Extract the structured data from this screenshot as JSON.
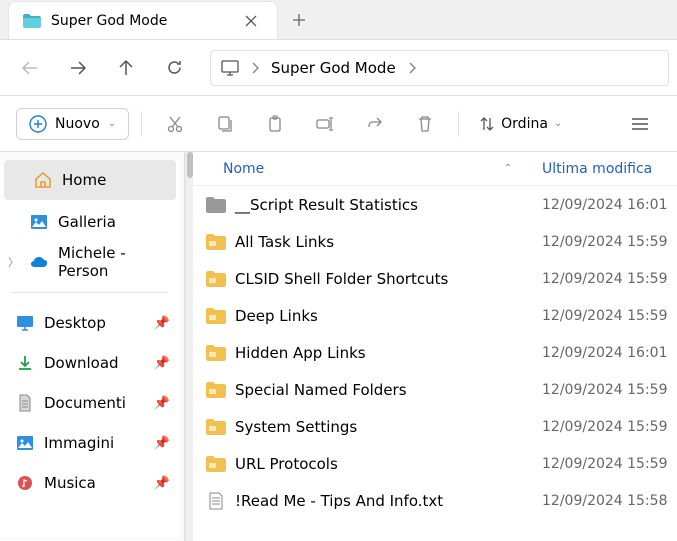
{
  "tab": {
    "title": "Super God Mode"
  },
  "breadcrumb": {
    "current": "Super God Mode"
  },
  "toolbar": {
    "new_label": "Nuovo",
    "sort_label": "Ordina"
  },
  "columns": {
    "name": "Nome",
    "modified": "Ultima modifica"
  },
  "sidebar": {
    "nav": [
      {
        "label": "Home",
        "icon": "home",
        "selected": true
      },
      {
        "label": "Galleria",
        "icon": "gallery"
      },
      {
        "label": "Michele - Person",
        "icon": "onedrive",
        "expandable": true
      }
    ],
    "quick": [
      {
        "label": "Desktop",
        "icon": "desktop"
      },
      {
        "label": "Download",
        "icon": "download"
      },
      {
        "label": "Documenti",
        "icon": "documents"
      },
      {
        "label": "Immagini",
        "icon": "pictures"
      },
      {
        "label": "Musica",
        "icon": "music"
      }
    ]
  },
  "files": [
    {
      "name": "__Script Result Statistics",
      "date": "12/09/2024 16:01",
      "icon": "folder-gray"
    },
    {
      "name": "All Task Links",
      "date": "12/09/2024 15:59",
      "icon": "folder-tasks"
    },
    {
      "name": "CLSID Shell Folder Shortcuts",
      "date": "12/09/2024 15:59",
      "icon": "folder-shell"
    },
    {
      "name": "Deep Links",
      "date": "12/09/2024 15:59",
      "icon": "folder-deep"
    },
    {
      "name": "Hidden App Links",
      "date": "12/09/2024 16:01",
      "icon": "folder-search"
    },
    {
      "name": "Special Named Folders",
      "date": "12/09/2024 15:59",
      "icon": "folder-special"
    },
    {
      "name": "System Settings",
      "date": "12/09/2024 15:59",
      "icon": "folder-gear"
    },
    {
      "name": "URL Protocols",
      "date": "12/09/2024 15:59",
      "icon": "folder-url"
    },
    {
      "name": "!Read Me - Tips And Info.txt",
      "date": "12/09/2024 15:58",
      "icon": "text-file"
    }
  ]
}
